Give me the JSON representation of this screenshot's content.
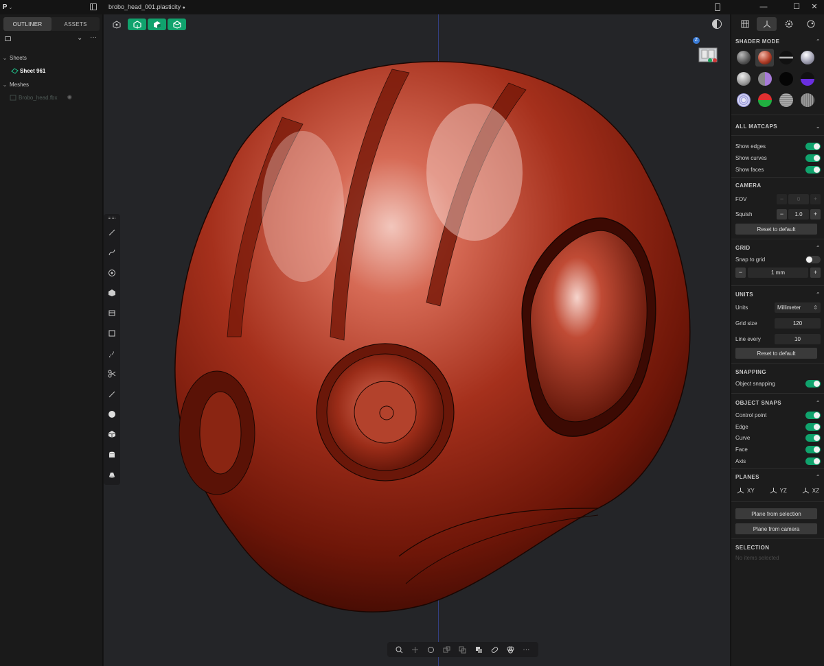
{
  "titlebar": {
    "logo": "P",
    "filename": "brobo_head_001.plasticity",
    "unsaved_dot": "●"
  },
  "outliner": {
    "tabs": [
      {
        "label": "OUTLINER",
        "active": true
      },
      {
        "label": "ASSETS",
        "active": false
      }
    ],
    "groups": [
      {
        "label": "Sheets",
        "items": [
          {
            "label": "Sheet 961",
            "selected": true
          }
        ]
      },
      {
        "label": "Meshes",
        "items": [
          {
            "label": "Brobo_head.fbx",
            "hidden": true
          }
        ]
      }
    ]
  },
  "viewport": {
    "top_buttons": [
      "box-select-icon",
      "vertex-mode-icon",
      "face-mode-icon",
      "solid-mode-icon"
    ],
    "nav_cube_label": "Z",
    "left_tools": [
      "line-icon",
      "curve-icon",
      "circle-icon",
      "polygon-icon",
      "extrude-icon",
      "rectangle-icon",
      "spline-icon",
      "scissors-icon",
      "fillet-curve-icon",
      "sphere-icon",
      "box-icon",
      "cylinder-icon",
      "cone-icon"
    ],
    "bottom_tools": [
      "zoom-icon",
      "move-icon",
      "rotate-icon",
      "scale-icon",
      "duplicate-icon",
      "boolean-icon",
      "fillet-icon",
      "union-icon",
      "more-icon"
    ],
    "model_color": "#b53a26"
  },
  "rightpanel": {
    "sections": {
      "shader_mode": "SHADER MODE",
      "all_matcaps": "ALL MATCAPS",
      "camera": "CAMERA",
      "grid": "GRID",
      "units": "UNITS",
      "snapping": "SNAPPING",
      "object_snaps": "OBJECT SNAPS",
      "planes": "PLANES",
      "selection": "SELECTION"
    },
    "display": {
      "show_edges": "Show edges",
      "show_curves": "Show curves",
      "show_faces": "Show faces"
    },
    "camera": {
      "fov_label": "FOV",
      "fov_value": "0",
      "squish_label": "Squish",
      "squish_value": "1.0",
      "reset": "Reset to default"
    },
    "grid": {
      "snap_label": "Snap to grid",
      "size_value": "1 mm"
    },
    "units": {
      "units_label": "Units",
      "units_value": "Millimeter",
      "grid_size_label": "Grid size",
      "grid_size_value": "120",
      "line_every_label": "Line every",
      "line_every_value": "10",
      "reset": "Reset to default"
    },
    "snapping": {
      "object_snapping": "Object snapping"
    },
    "object_snaps": {
      "control_point": "Control point",
      "edge": "Edge",
      "curve": "Curve",
      "face": "Face",
      "axis": "Axis"
    },
    "planes": {
      "xy": "XY",
      "yz": "YZ",
      "xz": "XZ",
      "from_selection": "Plane from selection",
      "from_camera": "Plane from camera"
    },
    "selection": {
      "empty": "No items selected"
    }
  },
  "colors": {
    "accent": "#10a36d",
    "panel": "#1c1c1c",
    "viewport": "#242528"
  }
}
